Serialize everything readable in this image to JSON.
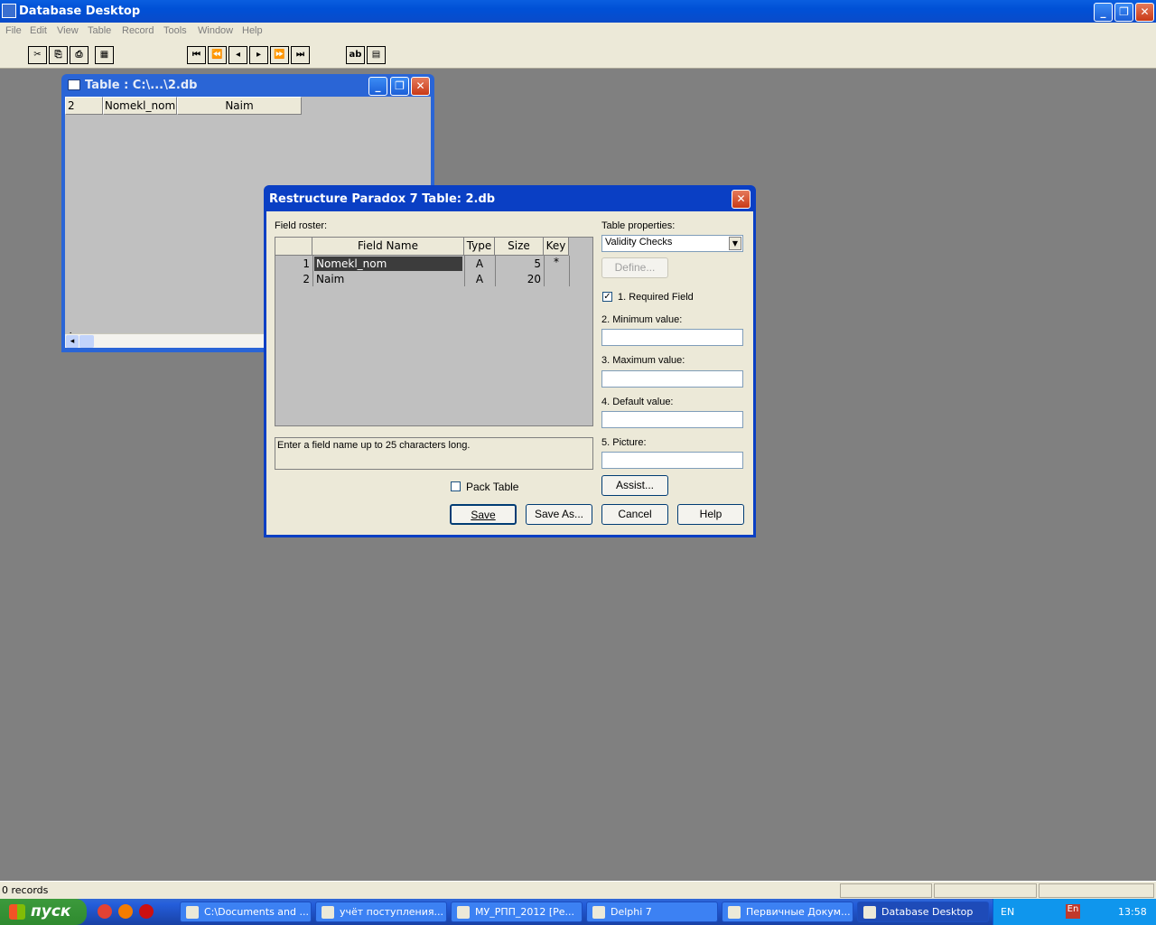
{
  "app": {
    "title": "Database Desktop",
    "min": "_",
    "max": "❐",
    "close": "✕"
  },
  "menu": [
    "File",
    "Edit",
    "View",
    "Table",
    "Record",
    "Tools",
    "Window",
    "Help"
  ],
  "toolbar": {
    "buttons": [
      "✂",
      "⎘",
      "⎙",
      "▦",
      "⏮",
      "⏪",
      "◂",
      "▸",
      "⏩",
      "⏭",
      "ab",
      "▤"
    ]
  },
  "table_window": {
    "title": "Table : C:\\...\\2.db",
    "headers": [
      "2",
      "Nomekl_nom",
      "Naim"
    ],
    "scroll_left": "◂"
  },
  "dialog": {
    "title": "Restructure Paradox 7 Table: 2.db",
    "close": "✕",
    "field_roster_label": "Field roster:",
    "columns": [
      "",
      "Field Name",
      "Type",
      "Size",
      "Key"
    ],
    "rows": [
      {
        "num": "1",
        "name": "Nomekl_nom",
        "type": "A",
        "size": "5",
        "key": "*"
      },
      {
        "num": "2",
        "name": "Naim",
        "type": "A",
        "size": "20",
        "key": ""
      }
    ],
    "hint": "Enter a field name up to 25 characters long.",
    "pack_table": "Pack Table",
    "table_properties_label": "Table properties:",
    "table_properties_value": "Validity Checks",
    "define": "Define...",
    "required_field": "1. Required Field",
    "required_checked": "✓",
    "min_value": "2. Minimum value:",
    "max_value": "3. Maximum value:",
    "default_value": "4. Default value:",
    "picture": "5. Picture:",
    "assist": "Assist...",
    "save": "Save",
    "save_as": "Save As...",
    "cancel": "Cancel",
    "help": "Help"
  },
  "status": {
    "records": "0 records"
  },
  "taskbar": {
    "start": "пуск",
    "tasks": [
      "C:\\Documents and ...",
      "учёт поступления...",
      "МУ_РПП_2012 [Ре...",
      "Delphi 7",
      "Первичные Докум...",
      "Database Desktop"
    ],
    "lang": "EN",
    "lang2": "En",
    "clock": "13:58"
  }
}
